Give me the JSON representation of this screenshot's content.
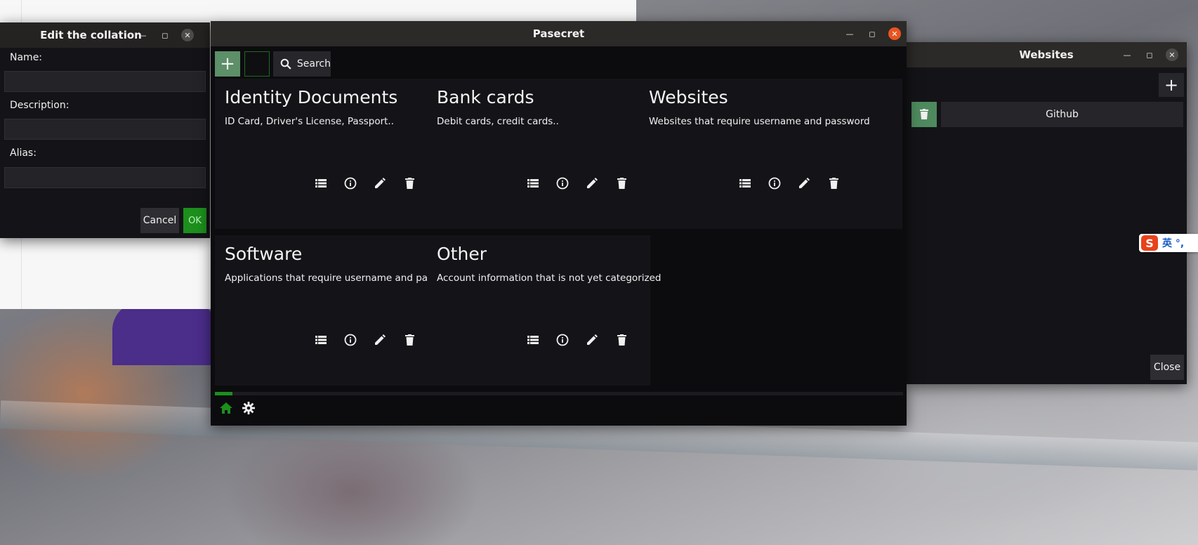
{
  "pasecret": {
    "title": "Pasecret",
    "toolbar": {
      "search_label": "Search"
    },
    "categories": [
      {
        "title": "Identity Documents",
        "description": "ID Card, Driver's License, Passport.."
      },
      {
        "title": "Bank cards",
        "description": "Debit cards, credit cards.."
      },
      {
        "title": "Websites",
        "description": "Websites that require username and password"
      },
      {
        "title": "Software",
        "description": "Applications that require username and password"
      },
      {
        "title": "Other",
        "description": "Account information that is not yet categorized"
      }
    ],
    "card_actions": [
      "list-icon",
      "info-icon",
      "edit-icon",
      "delete-icon"
    ],
    "progress": 0.026
  },
  "edit_dialog": {
    "title": "Edit the collation",
    "name_label": "Name:",
    "description_label": "Description:",
    "alias_label": "Alias:",
    "name_value": "",
    "description_value": "",
    "alias_value": "",
    "cancel_label": "Cancel",
    "ok_label": "OK"
  },
  "websites_window": {
    "title": "Websites",
    "items": [
      {
        "label": "Github"
      }
    ],
    "close_label": "Close"
  },
  "ime": {
    "logo": "S",
    "text": "英 °,"
  },
  "colors": {
    "accent_green": "#1c8f1c",
    "add_button_green": "#5d8f68",
    "close_active": "#e95420",
    "card_bg": "#141418"
  }
}
